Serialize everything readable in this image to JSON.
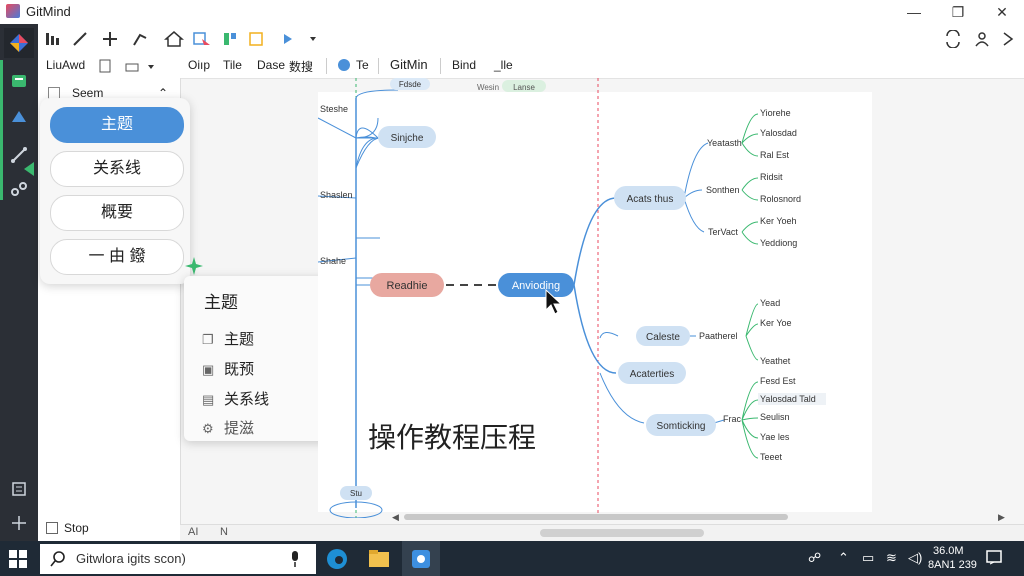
{
  "window": {
    "title": "GitMind",
    "minimize": "—",
    "maximize": "❐",
    "close": "✕"
  },
  "rail": {
    "items": [
      "app-logo",
      "theme-icon",
      "sticker-icon",
      "connector-icon",
      "share-icon",
      "outline-icon",
      "move-icon"
    ]
  },
  "toolbar": {
    "row1_icons": [
      "format-icon",
      "pen-icon",
      "add-icon",
      "pin-icon",
      "home-icon",
      "select-icon",
      "layout-icon",
      "frame-icon",
      "insert-icon",
      "dropdown-icon"
    ],
    "right_icons": [
      "sync-icon",
      "collab-icon",
      "expand-icon"
    ]
  },
  "toolbar2": {
    "left_label": "LiuAwd",
    "menus": [
      "Oiıp",
      "Tile",
      "Dase",
      "数搜"
    ],
    "tab_tr": "Te",
    "tab_gitmind": "GitMin",
    "tab_bind": "Bind",
    "tab_file": "_lle"
  },
  "left_panel": {
    "header": "Seem",
    "buttons": [
      "主题",
      "关系线",
      "概要",
      "一 由 鏺"
    ],
    "bottom_item": "Stop"
  },
  "context_menu": {
    "title": "主题",
    "items": [
      {
        "label": "主题",
        "icon": "copy-icon",
        "has_submenu": true
      },
      {
        "label": "既预",
        "icon": "note-icon",
        "has_submenu": false
      },
      {
        "label": "关系线",
        "icon": "doc-icon",
        "has_submenu": false
      },
      {
        "label": "提滋",
        "icon": "gear-icon",
        "has_submenu": false
      }
    ]
  },
  "overlay_caption": "操作教程压程",
  "mindmap": {
    "center_left": "Readhie",
    "center_right": "Anvioding",
    "left_nodes": [
      "Steshe",
      "Sinjche",
      "Shaslen",
      "Shahe"
    ],
    "top_nodes": [
      "Fdsde",
      "Wesin",
      "Lanse"
    ],
    "right_nodes": [
      "Acats thus",
      "Caleste",
      "Acaterties",
      "Somticking"
    ],
    "branch_labels": [
      "Yeatasth",
      "Sonthen",
      "TerVact",
      "Paatherel",
      "Frac"
    ],
    "leaves_group1": [
      "Yiorehe",
      "Yalosdad",
      "Ral Est",
      "Ridsit",
      "Rolosnord",
      "Ker Yoeh",
      "Yeddiong"
    ],
    "leaves_group2": [
      "Yead",
      "Ker Yoe",
      "Yeathet",
      "Fesd Est",
      "Yalosdad Tald",
      "Seulisn",
      "Yae les",
      "Teeet"
    ],
    "bottom_node": "Stu"
  },
  "statusbar": {
    "left": "AI",
    "right": "N"
  },
  "taskbar": {
    "search_text": "Gitwlora igits scon)",
    "clock_time": "36.0M",
    "clock_date": "8AN1 239"
  }
}
